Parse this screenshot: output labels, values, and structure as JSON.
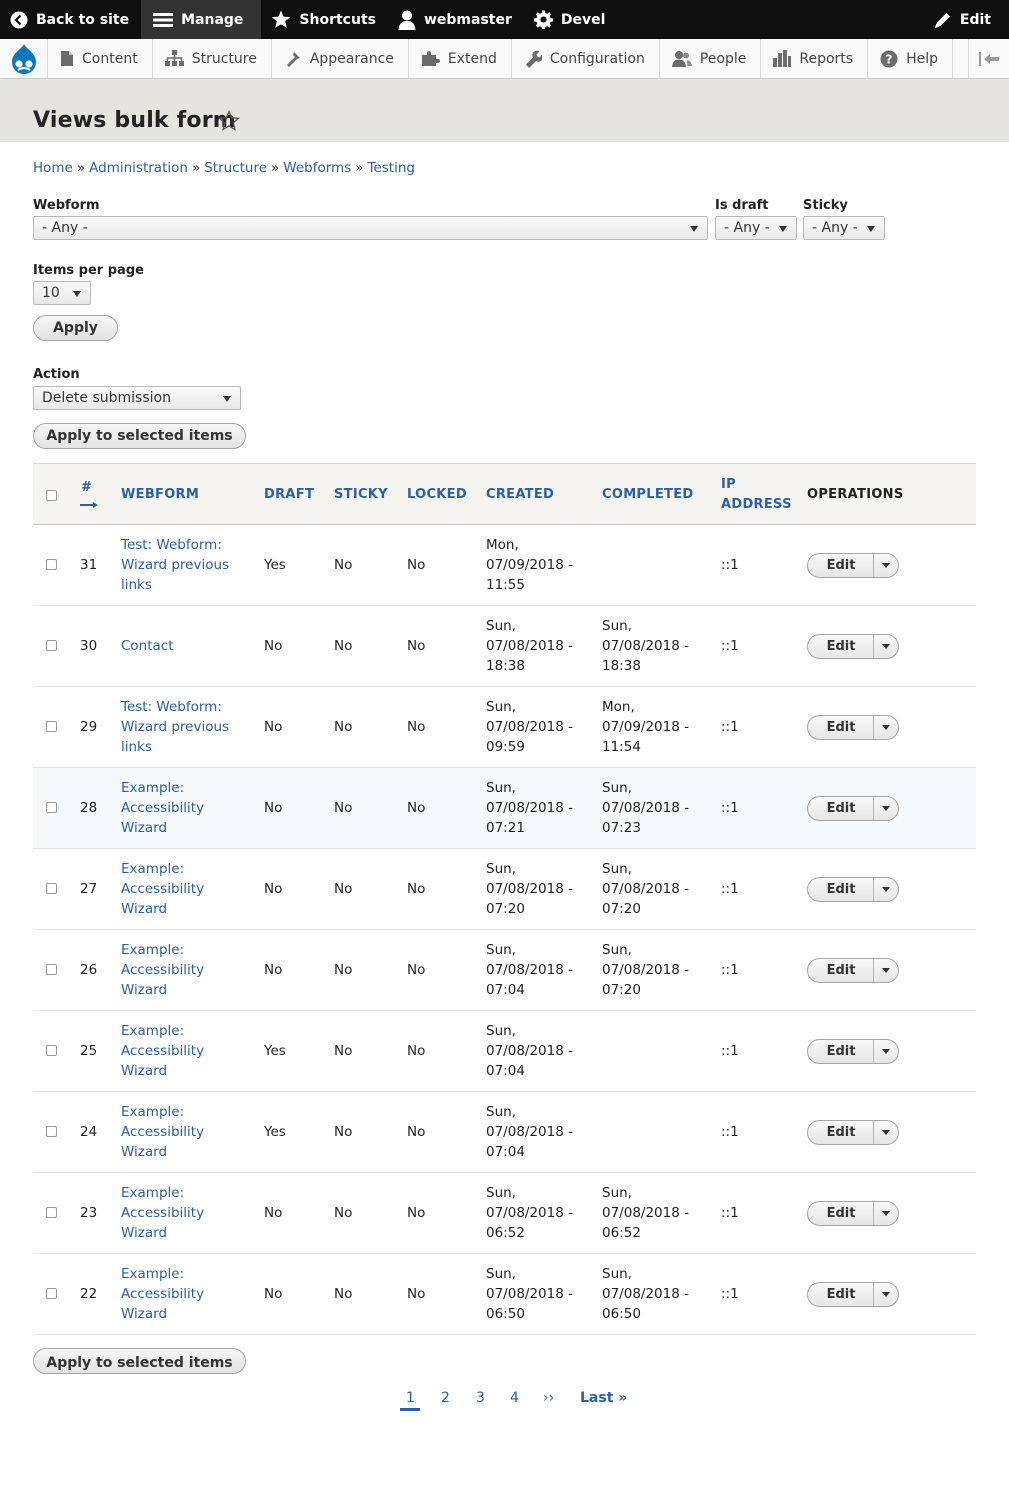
{
  "toolbar": {
    "back": "Back to site",
    "manage": "Manage",
    "shortcuts": "Shortcuts",
    "user": "webmaster",
    "devel": "Devel",
    "edit": "Edit"
  },
  "tray": {
    "items": [
      "Content",
      "Structure",
      "Appearance",
      "Extend",
      "Configuration",
      "People",
      "Reports",
      "Help"
    ]
  },
  "page": {
    "title": "Views bulk form"
  },
  "breadcrumb": [
    "Home",
    "Administration",
    "Structure",
    "Webforms",
    "Testing"
  ],
  "breadcrumb_sep": "»",
  "filters": {
    "webform_label": "Webform",
    "webform_value": "- Any -",
    "draft_label": "Is draft",
    "draft_value": "- Any -",
    "sticky_label": "Sticky",
    "sticky_value": "- Any -",
    "ipp_label": "Items per page",
    "ipp_value": "10",
    "apply": "Apply"
  },
  "bulk": {
    "action_label": "Action",
    "action_value": "Delete submission",
    "apply_selected": "Apply to selected items"
  },
  "table": {
    "headers": {
      "num": "#",
      "webform": "WEBFORM",
      "draft": "DRAFT",
      "sticky": "STICKY",
      "locked": "LOCKED",
      "created": "CREATED",
      "completed": "COMPLETED",
      "ip1": "IP",
      "ip2": "ADDRESS",
      "operations": "OPERATIONS"
    },
    "edit_label": "Edit",
    "rows": [
      {
        "num": "31",
        "webform": [
          "Test: Webform:",
          "Wizard previous",
          "links"
        ],
        "draft": "Yes",
        "sticky": "No",
        "locked": "No",
        "created": [
          "Mon,",
          "07/09/2018 -",
          "11:55"
        ],
        "completed": [],
        "ip": "::1"
      },
      {
        "num": "30",
        "webform": [
          "Contact"
        ],
        "draft": "No",
        "sticky": "No",
        "locked": "No",
        "created": [
          "Sun,",
          "07/08/2018 -",
          "18:38"
        ],
        "completed": [
          "Sun,",
          "07/08/2018 -",
          "18:38"
        ],
        "ip": "::1"
      },
      {
        "num": "29",
        "webform": [
          "Test: Webform:",
          "Wizard previous",
          "links"
        ],
        "draft": "No",
        "sticky": "No",
        "locked": "No",
        "created": [
          "Sun,",
          "07/08/2018 -",
          "09:59"
        ],
        "completed": [
          "Mon,",
          "07/09/2018 -",
          "11:54"
        ],
        "ip": "::1"
      },
      {
        "num": "28",
        "webform": [
          "Example:",
          "Accessibility",
          "Wizard"
        ],
        "draft": "No",
        "sticky": "No",
        "locked": "No",
        "created": [
          "Sun,",
          "07/08/2018 -",
          "07:21"
        ],
        "completed": [
          "Sun,",
          "07/08/2018 -",
          "07:23"
        ],
        "ip": "::1"
      },
      {
        "num": "27",
        "webform": [
          "Example:",
          "Accessibility",
          "Wizard"
        ],
        "draft": "No",
        "sticky": "No",
        "locked": "No",
        "created": [
          "Sun,",
          "07/08/2018 -",
          "07:20"
        ],
        "completed": [
          "Sun,",
          "07/08/2018 -",
          "07:20"
        ],
        "ip": "::1"
      },
      {
        "num": "26",
        "webform": [
          "Example:",
          "Accessibility",
          "Wizard"
        ],
        "draft": "No",
        "sticky": "No",
        "locked": "No",
        "created": [
          "Sun,",
          "07/08/2018 -",
          "07:04"
        ],
        "completed": [
          "Sun,",
          "07/08/2018 -",
          "07:20"
        ],
        "ip": "::1"
      },
      {
        "num": "25",
        "webform": [
          "Example:",
          "Accessibility",
          "Wizard"
        ],
        "draft": "Yes",
        "sticky": "No",
        "locked": "No",
        "created": [
          "Sun,",
          "07/08/2018 -",
          "07:04"
        ],
        "completed": [],
        "ip": "::1"
      },
      {
        "num": "24",
        "webform": [
          "Example:",
          "Accessibility",
          "Wizard"
        ],
        "draft": "Yes",
        "sticky": "No",
        "locked": "No",
        "created": [
          "Sun,",
          "07/08/2018 -",
          "07:04"
        ],
        "completed": [],
        "ip": "::1"
      },
      {
        "num": "23",
        "webform": [
          "Example:",
          "Accessibility",
          "Wizard"
        ],
        "draft": "No",
        "sticky": "No",
        "locked": "No",
        "created": [
          "Sun,",
          "07/08/2018 -",
          "06:52"
        ],
        "completed": [
          "Sun,",
          "07/08/2018 -",
          "06:52"
        ],
        "ip": "::1"
      },
      {
        "num": "22",
        "webform": [
          "Example:",
          "Accessibility",
          "Wizard"
        ],
        "draft": "No",
        "sticky": "No",
        "locked": "No",
        "created": [
          "Sun,",
          "07/08/2018 -",
          "06:50"
        ],
        "completed": [
          "Sun,",
          "07/08/2018 -",
          "06:50"
        ],
        "ip": "::1"
      }
    ]
  },
  "pager": {
    "pages": [
      "1",
      "2",
      "3",
      "4"
    ],
    "next": "››",
    "last": "Last »"
  }
}
